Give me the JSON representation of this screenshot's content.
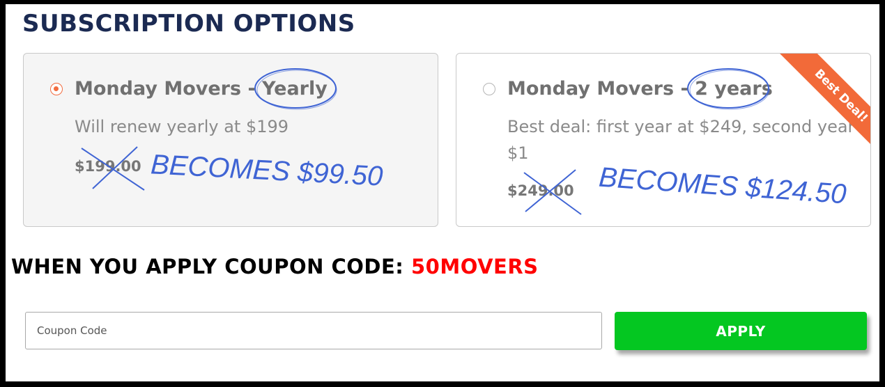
{
  "title": "SUBSCRIPTION OPTIONS",
  "plans": [
    {
      "name_prefix": "Monday Movers - ",
      "name_term": "Yearly",
      "description": "Will renew yearly at $199",
      "old_price": "$199.00",
      "annotation": "BECOMES $99.50",
      "selected": true
    },
    {
      "name_prefix": "Monday Movers - ",
      "name_term": "2 years",
      "description": "Best deal: first year at $249, second year $1",
      "old_price": "$249.00",
      "annotation": "BECOMES $124.50",
      "selected": false,
      "ribbon": "Best Deal!"
    }
  ],
  "coupon": {
    "headline": "WHEN YOU APPLY COUPON CODE: ",
    "code": "50MOVERS",
    "input_placeholder": "Coupon Code",
    "input_value": "",
    "apply_label": "APPLY"
  },
  "colors": {
    "title": "#1b2a52",
    "accent_orange": "#f26a39",
    "annotation_blue": "#3f64d4",
    "apply_green": "#04c721",
    "code_red": "#ff0000"
  }
}
